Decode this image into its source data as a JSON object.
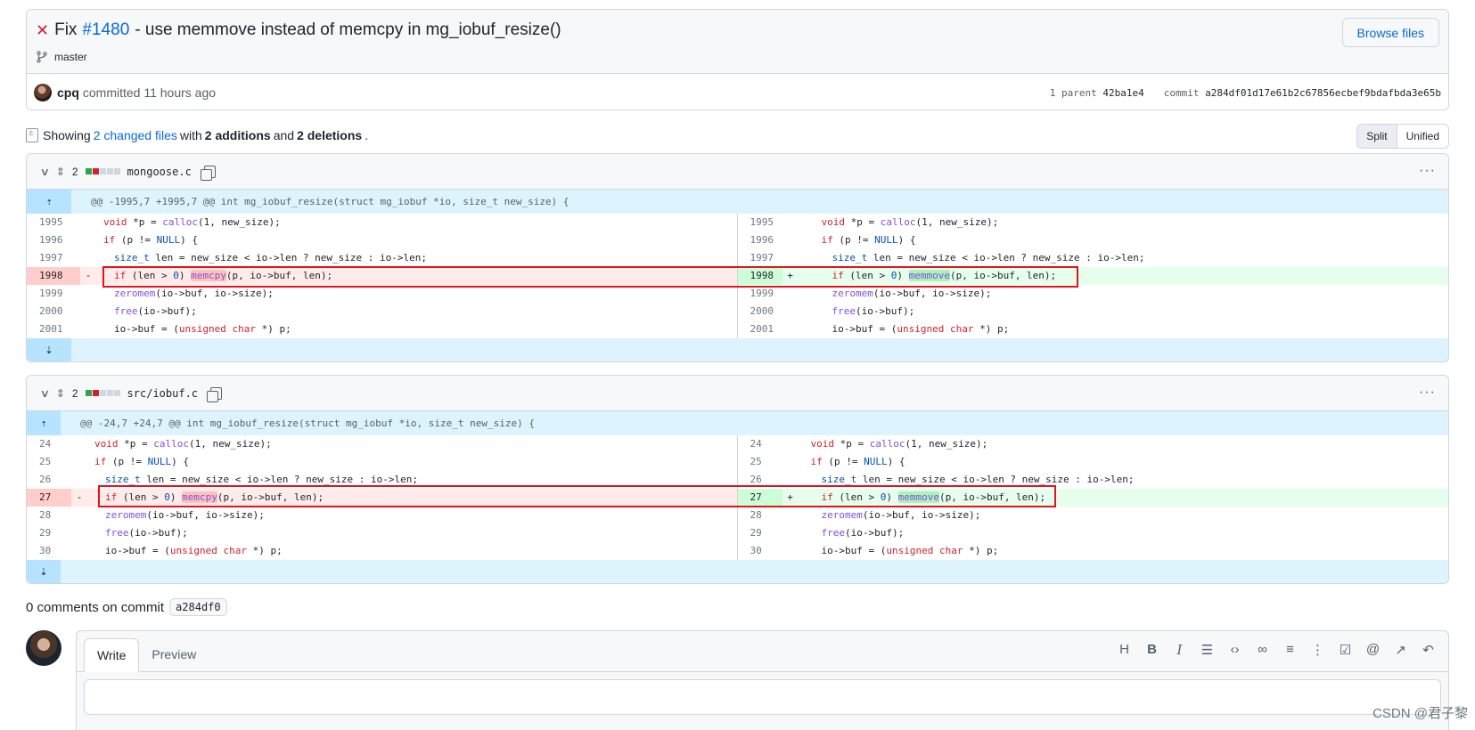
{
  "commit": {
    "status_icon": "x",
    "title_prefix": "Fix",
    "issue": "#1480",
    "title_suffix": "- use memmove instead of memcpy in mg_iobuf_resize()",
    "branch": "master",
    "browse_files": "Browse files",
    "author": "cpq",
    "committed_text": "committed 11 hours ago",
    "parent_label": "1 parent",
    "parent_sha": "42ba1e4",
    "commit_label": "commit",
    "commit_sha": "a284df01d17e61b2c67856ecbef9bdafbda3e65b"
  },
  "summary": {
    "showing": "Showing",
    "changed_files": "2 changed files",
    "with": "with",
    "additions": "2 additions",
    "and": "and",
    "deletions": "2 deletions",
    "period": "."
  },
  "view_toggle": {
    "split": "Split",
    "unified": "Unified"
  },
  "files": [
    {
      "changes": "2",
      "name": "mongoose.c",
      "hunk": "@@ -1995,7 +1995,7 @@ int mg_iobuf_resize(struct mg_iobuf *io, size_t new_size) {",
      "left_nums": [
        "1995",
        "1996",
        "1997",
        "1998",
        "1999",
        "2000",
        "2001"
      ],
      "right_nums": [
        "1995",
        "1996",
        "1997",
        "1998",
        "1999",
        "2000",
        "2001"
      ]
    },
    {
      "changes": "2",
      "name": "src/iobuf.c",
      "hunk": "@@ -24,7 +24,7 @@ int mg_iobuf_resize(struct mg_iobuf *io, size_t new_size) {",
      "left_nums": [
        "24",
        "25",
        "26",
        "27",
        "28",
        "29",
        "30"
      ],
      "right_nums": [
        "24",
        "25",
        "26",
        "27",
        "28",
        "29",
        "30"
      ]
    }
  ],
  "code": {
    "l1_a": "void",
    "l1_b": " *p = ",
    "l1_c": "calloc",
    "l1_d": "(1, new_size);",
    "l2_a": "if",
    "l2_b": " (p != ",
    "l2_c": "NULL",
    "l2_d": ") {",
    "l3_a": "size_t",
    "l3_b": " len = new_size < io->len ? new_size : io->len;",
    "l4_a": "if",
    "l4_b": " (len > ",
    "l4_c": "0",
    "l4_d": ") ",
    "l4_del_fn": "memcpy",
    "l4_add_fn": "memmove",
    "l4_e": "(p, io->buf, len);",
    "l5_a": "zeromem",
    "l5_b": "(io->buf, io->size);",
    "l6_a": "free",
    "l6_b": "(io->buf);",
    "l7_a": "io->buf = (",
    "l7_b": "unsigned",
    "l7_c": " ",
    "l7_d": "char",
    "l7_e": " *) p;",
    "minus": "-",
    "plus": "+"
  },
  "comments": {
    "title": "0 comments on commit",
    "sha": "a284df0",
    "write_tab": "Write",
    "preview_tab": "Preview"
  },
  "toolbar_icons": [
    "heading-icon",
    "bold-icon",
    "italic-icon",
    "quote-icon",
    "code-icon",
    "link-icon",
    "unordered-list-icon",
    "ordered-list-icon",
    "task-list-icon",
    "mention-icon",
    "reference-icon",
    "undo-icon"
  ],
  "watermark": "CSDN @君子黎",
  "colors": {
    "accent": "#0969da",
    "deletion": "#ffebe9",
    "addition": "#e6ffec",
    "hunk": "#ddf4ff",
    "annotation_box": "#e0141e"
  }
}
